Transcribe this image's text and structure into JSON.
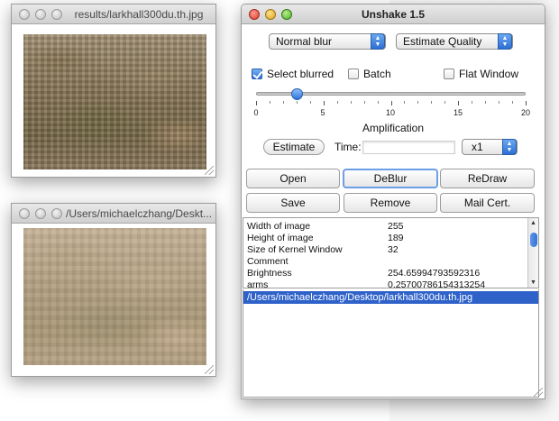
{
  "window1": {
    "title": "results/larkhall300du.th.jpg"
  },
  "window2": {
    "title": "/Users/michaelczhang/Deskt..."
  },
  "unshake": {
    "title": "Unshake 1.5",
    "blur_type": "Normal blur",
    "quality_mode": "Estimate Quality",
    "select_blurred_label": "Select blurred",
    "select_blurred_checked": true,
    "batch_label": "Batch",
    "batch_checked": false,
    "flat_window_label": "Flat Window",
    "flat_window_checked": false,
    "slider": {
      "value": 3,
      "min": 0,
      "max": 20,
      "tick_labels": [
        "0",
        "5",
        "10",
        "15",
        "20"
      ],
      "caption": "Amplification"
    },
    "estimate_button": "Estimate",
    "time_label": "Time:",
    "time_value": "",
    "zoom_value": "x1",
    "buttons": {
      "open": "Open",
      "deblur": "DeBlur",
      "redraw": "ReDraw",
      "save": "Save",
      "remove": "Remove",
      "mail_cert": "Mail Cert."
    },
    "info": [
      {
        "label": "Width of image",
        "value": "255"
      },
      {
        "label": "Height of image",
        "value": "189"
      },
      {
        "label": "Size of Kernel Window",
        "value": "32"
      },
      {
        "label": "Comment",
        "value": ""
      },
      {
        "label": "Brightness",
        "value": "254.65994793592316"
      },
      {
        "label": "arms",
        "value": "0.25700786154313254"
      }
    ],
    "file_list": [
      "/Users/michaelczhang/Desktop/larkhall300du.th.jpg"
    ]
  },
  "colors": {
    "selection": "#2f62c9",
    "accent_blue": "#2f72d8"
  }
}
